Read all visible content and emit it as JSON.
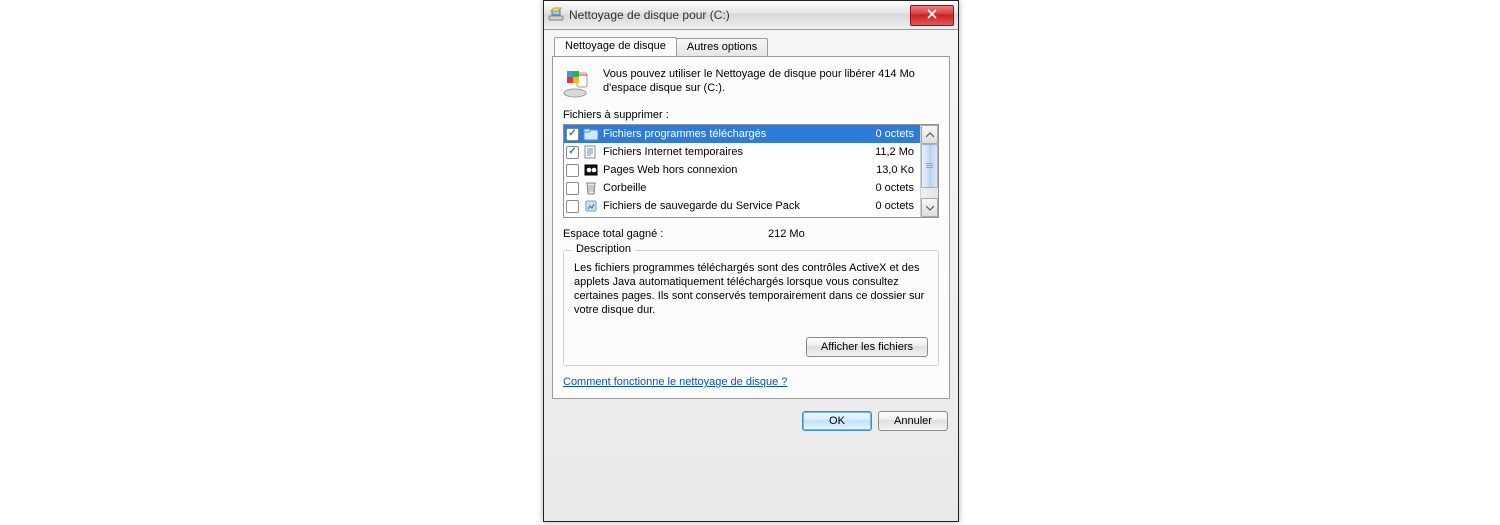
{
  "titlebar": {
    "title": "Nettoyage de disque pour  (C:)"
  },
  "tabs": {
    "active": "Nettoyage de disque",
    "inactive": "Autres options"
  },
  "intro": "Vous pouvez utiliser le Nettoyage de disque pour libérer 414 Mo d'espace disque sur  (C:).",
  "files_label": "Fichiers à supprimer :",
  "files": [
    {
      "label": "Fichiers programmes téléchargés",
      "size": "0 octets",
      "checked": true,
      "selected": true
    },
    {
      "label": "Fichiers Internet temporaires",
      "size": "11,2 Mo",
      "checked": true,
      "selected": false
    },
    {
      "label": "Pages Web hors connexion",
      "size": "13,0 Ko",
      "checked": false,
      "selected": false
    },
    {
      "label": "Corbeille",
      "size": "0 octets",
      "checked": false,
      "selected": false
    },
    {
      "label": "Fichiers de sauvegarde du Service Pack",
      "size": "0 octets",
      "checked": false,
      "selected": false
    }
  ],
  "total": {
    "label": "Espace total gagné :",
    "value": "212 Mo"
  },
  "group": {
    "legend": "Description",
    "text": "Les fichiers programmes téléchargés sont des contrôles ActiveX et des applets Java automatiquement téléchargés lorsque vous consultez certaines pages. Ils sont conservés temporairement dans ce dossier sur votre disque dur.",
    "view_files": "Afficher les fichiers"
  },
  "help_link": "Comment fonctionne le nettoyage de disque ?",
  "footer": {
    "ok": "OK",
    "cancel": "Annuler"
  }
}
